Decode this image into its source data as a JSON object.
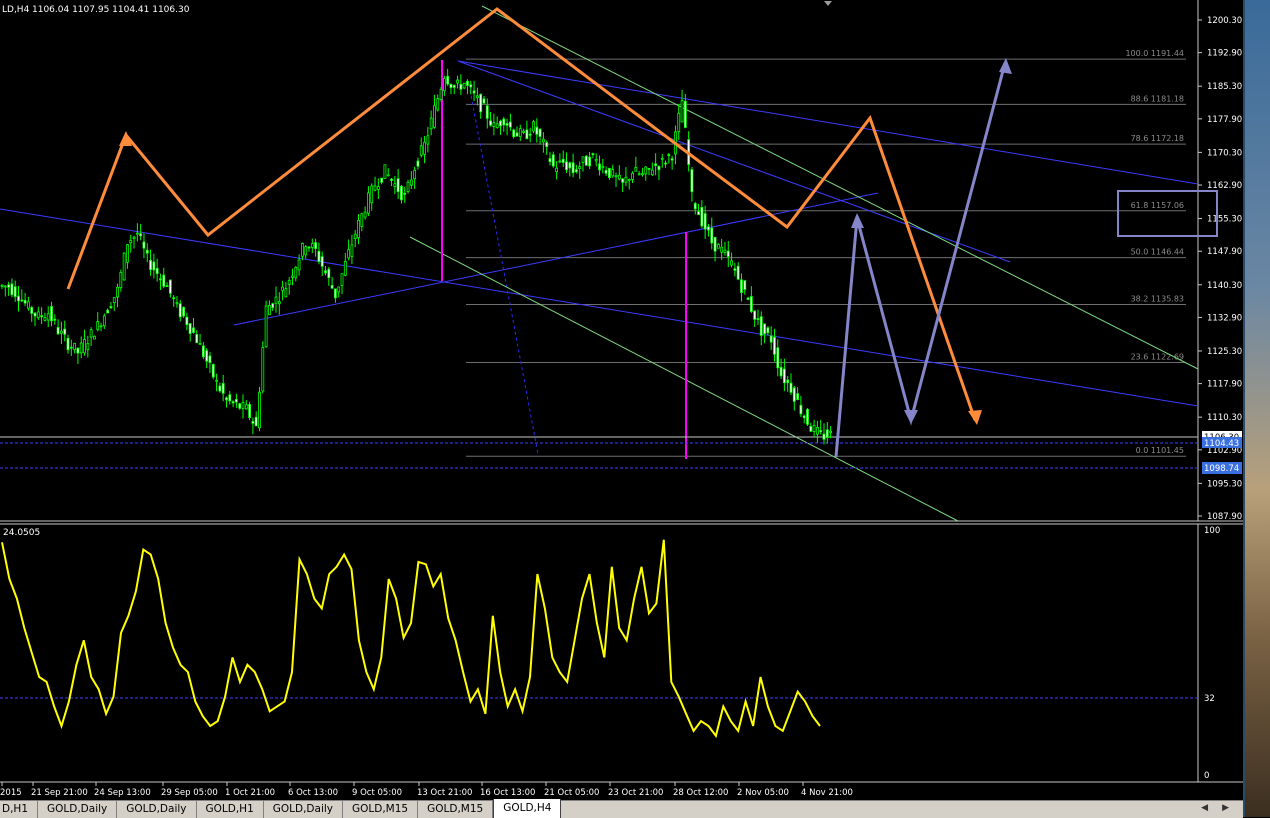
{
  "header": {
    "symbol_tf": "LD,H4",
    "ohlc": "1106.04 1107.95 1104.41 1106.30"
  },
  "price_axis": {
    "ticks": [
      "1200.30",
      "1192.90",
      "1185.30",
      "1177.90",
      "1170.30",
      "1162.90",
      "1155.30",
      "1147.90",
      "1140.30",
      "1132.90",
      "1125.30",
      "1117.90",
      "1110.30",
      "1102.90",
      "1095.30",
      "1087.90"
    ],
    "current_price": "1106.30",
    "bid_marker": "1104.43",
    "level_marker": "1098.74"
  },
  "fibonacci": [
    {
      "label": "100.0  1191.44",
      "price": 1191.44
    },
    {
      "label": "88.6  1181.18",
      "price": 1181.18
    },
    {
      "label": "78.6  1172.18",
      "price": 1172.18
    },
    {
      "label": "61.8  1157.06",
      "price": 1157.06
    },
    {
      "label": "50.0  1146.44",
      "price": 1146.44
    },
    {
      "label": "38.2  1135.83",
      "price": 1135.83
    },
    {
      "label": "23.6  1122.69",
      "price": 1122.69
    },
    {
      "label": "0.0  1101.45",
      "price": 1101.45
    }
  ],
  "time_axis": {
    "labels": [
      "2015",
      "21 Sep 21:00",
      "24 Sep 13:00",
      "29 Sep 05:00",
      "1 Oct 21:00",
      "6 Oct 13:00",
      "9 Oct 05:00",
      "13 Oct 21:00",
      "16 Oct 13:00",
      "21 Oct 05:00",
      "23 Oct 21:00",
      "28 Oct 12:00",
      "2 Nov 05:00",
      "4 Nov 21:00"
    ]
  },
  "indicator": {
    "value_label": "24.0505",
    "scale_top": "100",
    "scale_mid": "32",
    "scale_bottom": "0",
    "color": "#ffff00"
  },
  "tabs": [
    "D,H1",
    "GOLD,Daily",
    "GOLD,Daily",
    "GOLD,H1",
    "GOLD,Daily",
    "GOLD,M15",
    "GOLD,M15",
    "GOLD,H4"
  ],
  "active_tab": "GOLD,H4",
  "colors": {
    "candle": "#00ff00",
    "orange_path": "#ff8c3a",
    "purple_path": "#8585c9",
    "trend_blue": "#3c3cff",
    "channel_green": "#7fd87f",
    "magenta": "#ff00ff",
    "fib_line": "#6e6e6e",
    "target_box": "#8585c9"
  },
  "chart_data": {
    "type": "line",
    "series": [
      {
        "values": [
          1140,
          1138,
          1135,
          1133,
          1134,
          1130,
          1127,
          1125,
          1128,
          1131,
          1135,
          1139,
          1150,
          1152,
          1146,
          1143,
          1140,
          1135,
          1132,
          1128,
          1123,
          1118,
          1114,
          1113,
          1112,
          1108,
          1135,
          1137,
          1140,
          1145,
          1150,
          1148,
          1143,
          1138,
          1145,
          1152,
          1158,
          1163,
          1166,
          1163,
          1160,
          1167,
          1172,
          1180,
          1188,
          1185,
          1186,
          1183,
          1180,
          1176,
          1178,
          1175,
          1174,
          1176,
          1172,
          1167,
          1168,
          1166,
          1168,
          1169,
          1167,
          1165,
          1163,
          1166,
          1165,
          1167,
          1168,
          1170,
          1182,
          1160,
          1155,
          1150,
          1148,
          1145,
          1140,
          1135,
          1130,
          1128,
          1120,
          1117,
          1112,
          1108,
          1106,
          1106.3
        ]
      }
    ],
    "price_ylim": [
      1087.9,
      1200.3
    ],
    "indicator": {
      "values": [
        95,
        80,
        72,
        60,
        50,
        40,
        38,
        28,
        20,
        30,
        45,
        55,
        40,
        35,
        25,
        32,
        58,
        65,
        75,
        92,
        90,
        80,
        62,
        52,
        45,
        42,
        30,
        24,
        20,
        22,
        32,
        48,
        38,
        45,
        42,
        35,
        26,
        28,
        30,
        42,
        88,
        82,
        72,
        68,
        82,
        85,
        90,
        84,
        55,
        42,
        35,
        48,
        80,
        72,
        56,
        62,
        87,
        86,
        77,
        82,
        64,
        55,
        42,
        30,
        35,
        25,
        65,
        42,
        28,
        35,
        26,
        40,
        82,
        68,
        48,
        42,
        38,
        55,
        72,
        82,
        62,
        48,
        85,
        60,
        55,
        72,
        85,
        66,
        70,
        96,
        38,
        32,
        25,
        18,
        22,
        20,
        16,
        28,
        22,
        18,
        30,
        20,
        40,
        28,
        20,
        18,
        26,
        34,
        30,
        24,
        20
      ],
      "ylim": [
        0,
        100
      ],
      "level": 32
    }
  }
}
